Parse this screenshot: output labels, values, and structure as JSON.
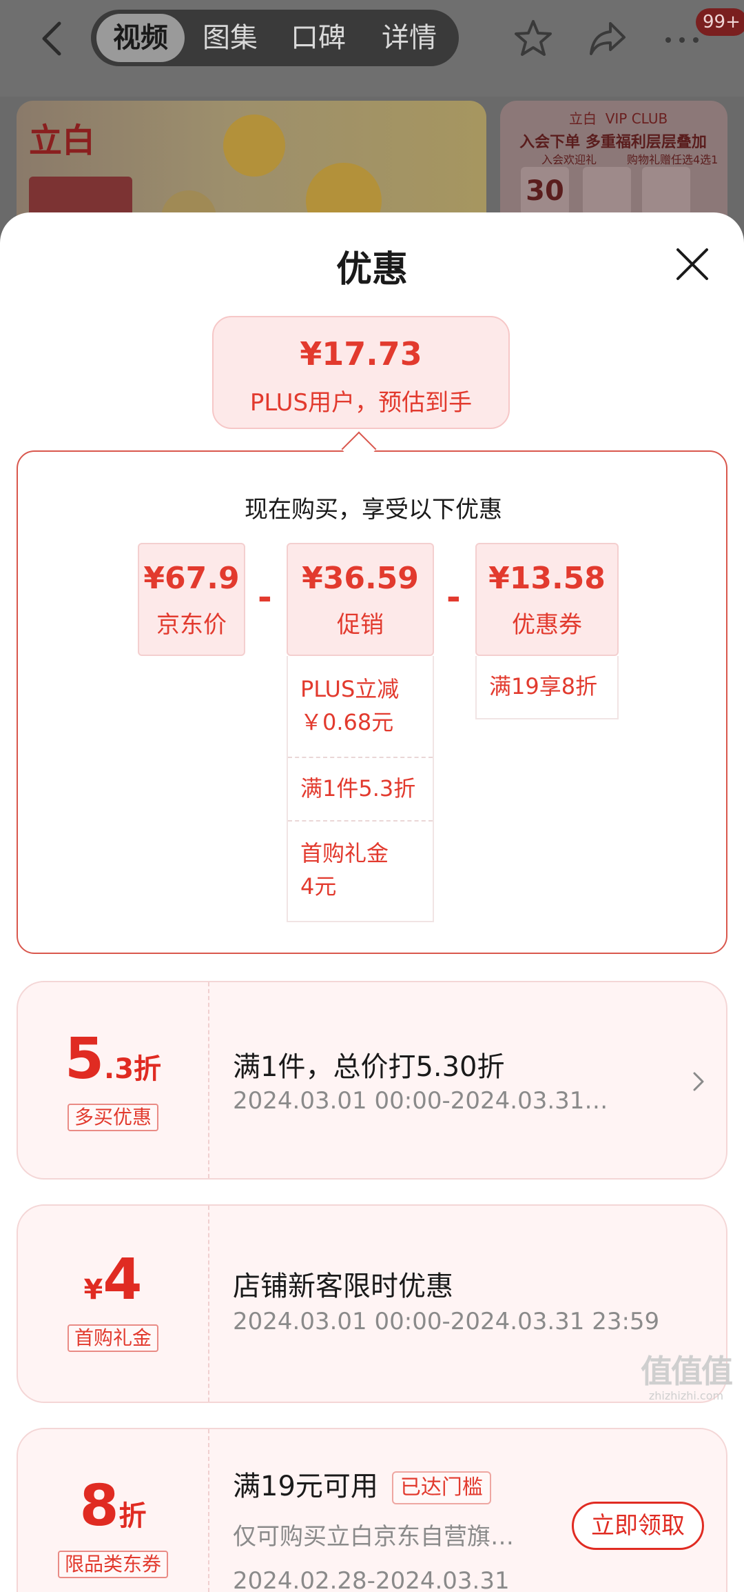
{
  "topbar": {
    "tabs": [
      {
        "label": "视频",
        "active": true
      },
      {
        "label": "图集",
        "active": false
      },
      {
        "label": "口碑",
        "active": false
      },
      {
        "label": "详情",
        "active": false
      }
    ],
    "badge": "99+"
  },
  "banner_left": {
    "logo": "立白"
  },
  "banner_right": {
    "logo": "立白",
    "club": "VIP CLUB",
    "headline": "入会下单 多重福利层层叠加",
    "left_label": "入会欢迎礼",
    "right_label": "购物礼赠任选4选1",
    "big_number": "30"
  },
  "sheet": {
    "title": "优惠",
    "estimate": {
      "price": "¥17.73",
      "label": "PLUS用户，预估到手"
    },
    "breakdown": {
      "heading": "现在购买，享受以下优惠",
      "jd_price": {
        "value": "¥67.9",
        "label": "京东价"
      },
      "promo": {
        "value": "¥36.59",
        "label": "促销",
        "items": [
          {
            "line1": "PLUS立减",
            "line2": "￥0.68元"
          },
          {
            "line1": "满1件5.3折",
            "line2": ""
          },
          {
            "line1": "首购礼金",
            "line2": "4元"
          }
        ]
      },
      "coupon": {
        "value": "¥13.58",
        "label": "优惠券",
        "items": [
          {
            "line1": "满19享8折"
          }
        ]
      },
      "minus": "-"
    },
    "coupons": [
      {
        "big_main": "5",
        "big_suffix": ".3折",
        "tag": "多买优惠",
        "title": "满1件，总价打5.30折",
        "desc": "2024.03.01 00:00-2024.03.31…"
      },
      {
        "big_prefix": "¥",
        "big_main": "4",
        "tag": "首购礼金",
        "title": "店铺新客限时优惠",
        "desc": "2024.03.01 00:00-2024.03.31 23:59"
      },
      {
        "big_main": "8",
        "big_suffix": "折",
        "tag": "限品类东券",
        "title": "满19元可用",
        "title_badge": "已达门槛",
        "desc": "仅可购买立白京东自营旗…",
        "desc2": "2024.02.28-2024.03.31",
        "button": "立即领取"
      }
    ]
  },
  "watermark": {
    "main": "值值值",
    "sub": "zhizhizhi.com"
  },
  "colors": {
    "accent": "#e23a2e",
    "card_bg": "#fde9e9",
    "coupon_bg": "#fff4f4"
  }
}
